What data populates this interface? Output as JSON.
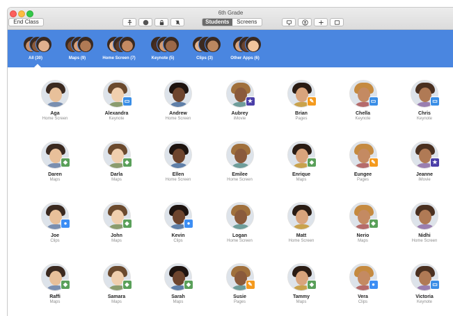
{
  "window": {
    "title": "6th Grade"
  },
  "toolbar": {
    "end_class_label": "End Class",
    "icons": [
      "navigate-icon",
      "safari-compass-icon",
      "lock-icon",
      "mute-icon"
    ],
    "view_tabs": [
      {
        "label": "Students",
        "active": true
      },
      {
        "label": "Screens",
        "active": false
      }
    ],
    "right_icons": [
      "airplay-icon",
      "person-circle-icon",
      "plus-icon",
      "sidebar-icon"
    ]
  },
  "groups": [
    {
      "label": "All (30)",
      "selected": true
    },
    {
      "label": "Maps (9)",
      "selected": false
    },
    {
      "label": "Home Screen (7)",
      "selected": false
    },
    {
      "label": "Keynote (5)",
      "selected": false
    },
    {
      "label": "Clips (3)",
      "selected": false
    },
    {
      "label": "Other Apps (6)",
      "selected": false
    }
  ],
  "app_colors": {
    "Keynote": "#3a8ee6",
    "Maps": "#5aa05a",
    "iMovie": "#4b3fa8",
    "Pages": "#f49a1e",
    "Clips": "#3d8ef4",
    "Home Screen": ""
  },
  "students": [
    {
      "name": "Aga",
      "app": "Home Screen"
    },
    {
      "name": "Alexandra",
      "app": "Keynote"
    },
    {
      "name": "Andrew",
      "app": "Home Screen"
    },
    {
      "name": "Aubrey",
      "app": "iMovie"
    },
    {
      "name": "Brian",
      "app": "Pages"
    },
    {
      "name": "Chella",
      "app": "Keynote"
    },
    {
      "name": "Chris",
      "app": "Keynote"
    },
    {
      "name": "Daren",
      "app": "Maps"
    },
    {
      "name": "Darla",
      "app": "Maps"
    },
    {
      "name": "Ellen",
      "app": "Home Screen"
    },
    {
      "name": "Emilee",
      "app": "Home Screen"
    },
    {
      "name": "Enrique",
      "app": "Maps"
    },
    {
      "name": "Eungee",
      "app": "Pages"
    },
    {
      "name": "Jeanne",
      "app": "iMovie"
    },
    {
      "name": "Joe",
      "app": "Clips"
    },
    {
      "name": "John",
      "app": "Maps"
    },
    {
      "name": "Kevin",
      "app": "Clips"
    },
    {
      "name": "Logan",
      "app": "Home Screen"
    },
    {
      "name": "Matt",
      "app": "Home Screen"
    },
    {
      "name": "Nerio",
      "app": "Maps"
    },
    {
      "name": "Nidhi",
      "app": "Home Screen"
    },
    {
      "name": "Raffi",
      "app": "Maps"
    },
    {
      "name": "Samara",
      "app": "Maps"
    },
    {
      "name": "Sarah",
      "app": "Maps"
    },
    {
      "name": "Susie",
      "app": "Pages"
    },
    {
      "name": "Tammy",
      "app": "Maps"
    },
    {
      "name": "Vera",
      "app": "Clips"
    },
    {
      "name": "Victoria",
      "app": "Keynote"
    }
  ]
}
